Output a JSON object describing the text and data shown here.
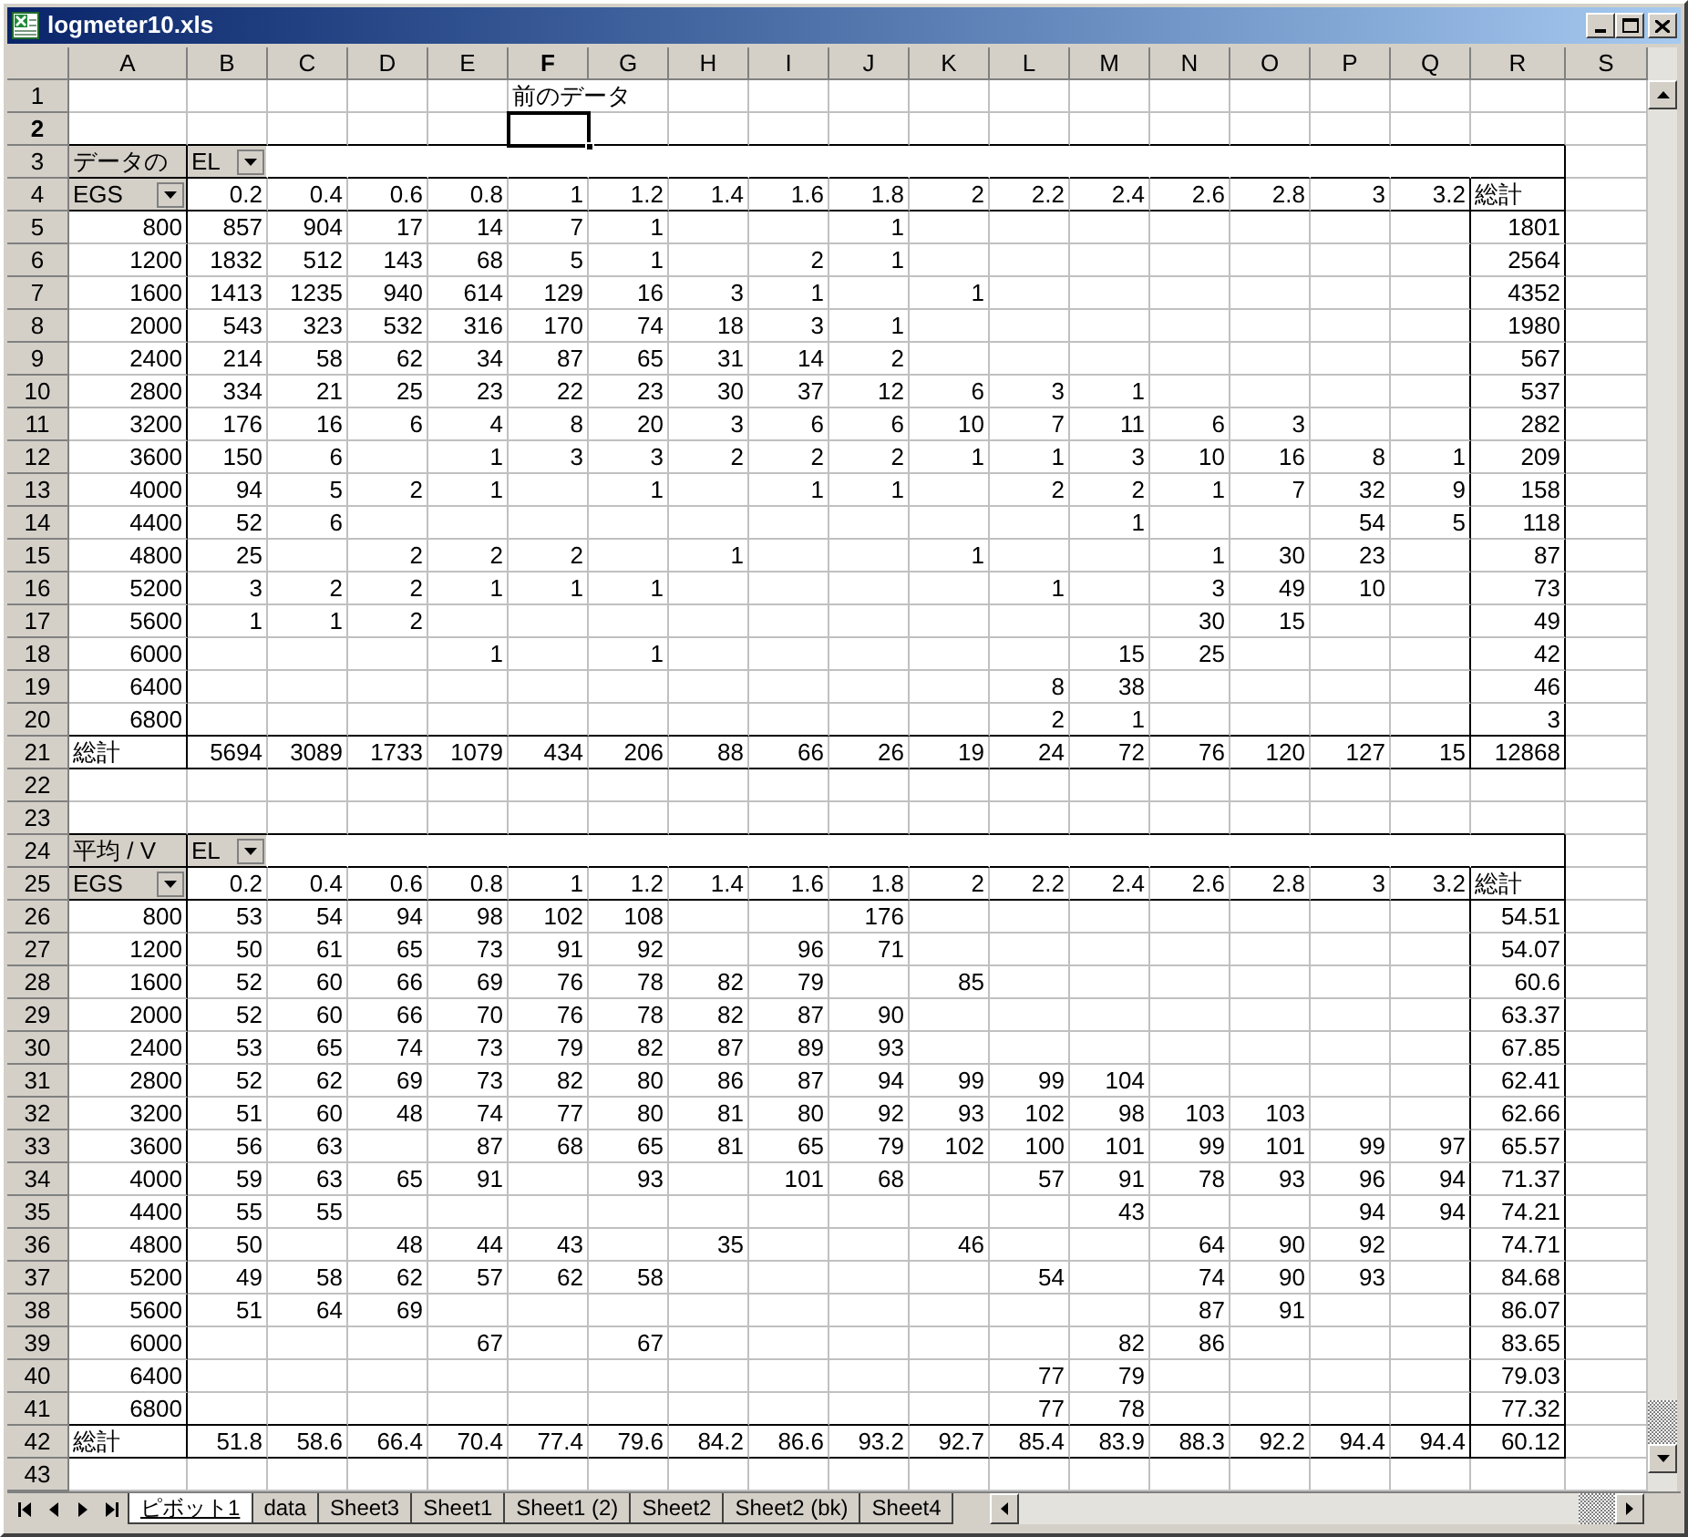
{
  "window": {
    "title": "logmeter10.xls"
  },
  "columns": [
    {
      "label": "A",
      "selected": false
    },
    {
      "label": "B",
      "selected": false
    },
    {
      "label": "C",
      "selected": false
    },
    {
      "label": "D",
      "selected": false
    },
    {
      "label": "E",
      "selected": false
    },
    {
      "label": "F",
      "selected": true
    },
    {
      "label": "G",
      "selected": false
    },
    {
      "label": "H",
      "selected": false
    },
    {
      "label": "I",
      "selected": false
    },
    {
      "label": "J",
      "selected": false
    },
    {
      "label": "K",
      "selected": false
    },
    {
      "label": "L",
      "selected": false
    },
    {
      "label": "M",
      "selected": false
    },
    {
      "label": "N",
      "selected": false
    },
    {
      "label": "O",
      "selected": false
    },
    {
      "label": "P",
      "selected": false
    },
    {
      "label": "Q",
      "selected": false
    },
    {
      "label": "R",
      "selected": false
    },
    {
      "label": "S",
      "selected": false
    }
  ],
  "rows": [
    {
      "number": "1",
      "selected": false,
      "kind": "blank",
      "cells": [
        null,
        null,
        null,
        null,
        null,
        {
          "text": "前のデータ",
          "kind": "label"
        }
      ]
    },
    {
      "number": "2",
      "selected": true,
      "kind": "blank",
      "cells": []
    },
    {
      "number": "3",
      "selected": false,
      "kind": "pivot_title",
      "cells": [
        {
          "text": "データの",
          "kind": "field",
          "dropdown": false
        },
        {
          "text": "EL",
          "kind": "field",
          "dropdown": true
        }
      ]
    },
    {
      "number": "4",
      "selected": false,
      "kind": "pivot_header",
      "cells": [
        {
          "text": "EGS",
          "kind": "field",
          "dropdown": true
        },
        "0.2",
        "0.4",
        "0.6",
        "0.8",
        "1",
        "1.2",
        "1.4",
        "1.6",
        "1.8",
        "2",
        "2.2",
        "2.4",
        "2.6",
        "2.8",
        "3",
        "3.2",
        {
          "text": "総計",
          "kind": "label"
        }
      ]
    },
    {
      "number": "5",
      "selected": false,
      "kind": "pivot_body",
      "cells": [
        "800",
        "857",
        "904",
        "17",
        "14",
        "7",
        "1",
        null,
        null,
        "1",
        null,
        null,
        null,
        null,
        null,
        null,
        null,
        "1801"
      ]
    },
    {
      "number": "6",
      "selected": false,
      "kind": "pivot_body",
      "cells": [
        "1200",
        "1832",
        "512",
        "143",
        "68",
        "5",
        "1",
        null,
        "2",
        "1",
        null,
        null,
        null,
        null,
        null,
        null,
        null,
        "2564"
      ]
    },
    {
      "number": "7",
      "selected": false,
      "kind": "pivot_body",
      "cells": [
        "1600",
        "1413",
        "1235",
        "940",
        "614",
        "129",
        "16",
        "3",
        "1",
        null,
        "1",
        null,
        null,
        null,
        null,
        null,
        null,
        "4352"
      ]
    },
    {
      "number": "8",
      "selected": false,
      "kind": "pivot_body",
      "cells": [
        "2000",
        "543",
        "323",
        "532",
        "316",
        "170",
        "74",
        "18",
        "3",
        "1",
        null,
        null,
        null,
        null,
        null,
        null,
        null,
        "1980"
      ]
    },
    {
      "number": "9",
      "selected": false,
      "kind": "pivot_body",
      "cells": [
        "2400",
        "214",
        "58",
        "62",
        "34",
        "87",
        "65",
        "31",
        "14",
        "2",
        null,
        null,
        null,
        null,
        null,
        null,
        null,
        "567"
      ]
    },
    {
      "number": "10",
      "selected": false,
      "kind": "pivot_body",
      "cells": [
        "2800",
        "334",
        "21",
        "25",
        "23",
        "22",
        "23",
        "30",
        "37",
        "12",
        "6",
        "3",
        "1",
        null,
        null,
        null,
        null,
        "537"
      ]
    },
    {
      "number": "11",
      "selected": false,
      "kind": "pivot_body",
      "cells": [
        "3200",
        "176",
        "16",
        "6",
        "4",
        "8",
        "20",
        "3",
        "6",
        "6",
        "10",
        "7",
        "11",
        "6",
        "3",
        null,
        null,
        "282"
      ]
    },
    {
      "number": "12",
      "selected": false,
      "kind": "pivot_body",
      "cells": [
        "3600",
        "150",
        "6",
        null,
        "1",
        "3",
        "3",
        "2",
        "2",
        "2",
        "1",
        "1",
        "3",
        "10",
        "16",
        "8",
        "1",
        "209"
      ]
    },
    {
      "number": "13",
      "selected": false,
      "kind": "pivot_body",
      "cells": [
        "4000",
        "94",
        "5",
        "2",
        "1",
        null,
        "1",
        null,
        "1",
        "1",
        null,
        "2",
        "2",
        "1",
        "7",
        "32",
        "9",
        "158"
      ]
    },
    {
      "number": "14",
      "selected": false,
      "kind": "pivot_body",
      "cells": [
        "4400",
        "52",
        "6",
        null,
        null,
        null,
        null,
        null,
        null,
        null,
        null,
        null,
        "1",
        null,
        null,
        "54",
        "5",
        "118"
      ]
    },
    {
      "number": "15",
      "selected": false,
      "kind": "pivot_body",
      "cells": [
        "4800",
        "25",
        null,
        "2",
        "2",
        "2",
        null,
        "1",
        null,
        null,
        "1",
        null,
        null,
        "1",
        "30",
        "23",
        null,
        "87"
      ]
    },
    {
      "number": "16",
      "selected": false,
      "kind": "pivot_body",
      "cells": [
        "5200",
        "3",
        "2",
        "2",
        "1",
        "1",
        "1",
        null,
        null,
        null,
        null,
        "1",
        null,
        "3",
        "49",
        "10",
        null,
        "73"
      ]
    },
    {
      "number": "17",
      "selected": false,
      "kind": "pivot_body",
      "cells": [
        "5600",
        "1",
        "1",
        "2",
        null,
        null,
        null,
        null,
        null,
        null,
        null,
        null,
        null,
        "30",
        "15",
        null,
        null,
        "49"
      ]
    },
    {
      "number": "18",
      "selected": false,
      "kind": "pivot_body",
      "cells": [
        "6000",
        null,
        null,
        null,
        "1",
        null,
        "1",
        null,
        null,
        null,
        null,
        null,
        "15",
        "25",
        null,
        null,
        null,
        "42"
      ]
    },
    {
      "number": "19",
      "selected": false,
      "kind": "pivot_body",
      "cells": [
        "6400",
        null,
        null,
        null,
        null,
        null,
        null,
        null,
        null,
        null,
        null,
        "8",
        "38",
        null,
        null,
        null,
        null,
        "46"
      ]
    },
    {
      "number": "20",
      "selected": false,
      "kind": "pivot_body",
      "cells": [
        "6800",
        null,
        null,
        null,
        null,
        null,
        null,
        null,
        null,
        null,
        null,
        "2",
        "1",
        null,
        null,
        null,
        null,
        "3"
      ]
    },
    {
      "number": "21",
      "selected": false,
      "kind": "pivot_total",
      "cells": [
        {
          "text": "総計",
          "kind": "label"
        },
        "5694",
        "3089",
        "1733",
        "1079",
        "434",
        "206",
        "88",
        "66",
        "26",
        "19",
        "24",
        "72",
        "76",
        "120",
        "127",
        "15",
        "12868"
      ]
    },
    {
      "number": "22",
      "selected": false,
      "kind": "blank",
      "cells": []
    },
    {
      "number": "23",
      "selected": false,
      "kind": "blank",
      "cells": []
    },
    {
      "number": "24",
      "selected": false,
      "kind": "pivot_title",
      "cells": [
        {
          "text": "平均 / V",
          "kind": "field",
          "dropdown": false
        },
        {
          "text": "EL",
          "kind": "field",
          "dropdown": true
        }
      ]
    },
    {
      "number": "25",
      "selected": false,
      "kind": "pivot_header",
      "cells": [
        {
          "text": "EGS",
          "kind": "field",
          "dropdown": true
        },
        "0.2",
        "0.4",
        "0.6",
        "0.8",
        "1",
        "1.2",
        "1.4",
        "1.6",
        "1.8",
        "2",
        "2.2",
        "2.4",
        "2.6",
        "2.8",
        "3",
        "3.2",
        {
          "text": "総計",
          "kind": "label"
        }
      ]
    },
    {
      "number": "26",
      "selected": false,
      "kind": "pivot_body",
      "cells": [
        "800",
        "53",
        "54",
        "94",
        "98",
        "102",
        "108",
        null,
        null,
        "176",
        null,
        null,
        null,
        null,
        null,
        null,
        null,
        "54.51"
      ]
    },
    {
      "number": "27",
      "selected": false,
      "kind": "pivot_body",
      "cells": [
        "1200",
        "50",
        "61",
        "65",
        "73",
        "91",
        "92",
        null,
        "96",
        "71",
        null,
        null,
        null,
        null,
        null,
        null,
        null,
        "54.07"
      ]
    },
    {
      "number": "28",
      "selected": false,
      "kind": "pivot_body",
      "cells": [
        "1600",
        "52",
        "60",
        "66",
        "69",
        "76",
        "78",
        "82",
        "79",
        null,
        "85",
        null,
        null,
        null,
        null,
        null,
        null,
        "60.6"
      ]
    },
    {
      "number": "29",
      "selected": false,
      "kind": "pivot_body",
      "cells": [
        "2000",
        "52",
        "60",
        "66",
        "70",
        "76",
        "78",
        "82",
        "87",
        "90",
        null,
        null,
        null,
        null,
        null,
        null,
        null,
        "63.37"
      ]
    },
    {
      "number": "30",
      "selected": false,
      "kind": "pivot_body",
      "cells": [
        "2400",
        "53",
        "65",
        "74",
        "73",
        "79",
        "82",
        "87",
        "89",
        "93",
        null,
        null,
        null,
        null,
        null,
        null,
        null,
        "67.85"
      ]
    },
    {
      "number": "31",
      "selected": false,
      "kind": "pivot_body",
      "cells": [
        "2800",
        "52",
        "62",
        "69",
        "73",
        "82",
        "80",
        "86",
        "87",
        "94",
        "99",
        "99",
        "104",
        null,
        null,
        null,
        null,
        "62.41"
      ]
    },
    {
      "number": "32",
      "selected": false,
      "kind": "pivot_body",
      "cells": [
        "3200",
        "51",
        "60",
        "48",
        "74",
        "77",
        "80",
        "81",
        "80",
        "92",
        "93",
        "102",
        "98",
        "103",
        "103",
        null,
        null,
        "62.66"
      ]
    },
    {
      "number": "33",
      "selected": false,
      "kind": "pivot_body",
      "cells": [
        "3600",
        "56",
        "63",
        null,
        "87",
        "68",
        "65",
        "81",
        "65",
        "79",
        "102",
        "100",
        "101",
        "99",
        "101",
        "99",
        "97",
        "65.57"
      ]
    },
    {
      "number": "34",
      "selected": false,
      "kind": "pivot_body",
      "cells": [
        "4000",
        "59",
        "63",
        "65",
        "91",
        null,
        "93",
        null,
        "101",
        "68",
        null,
        "57",
        "91",
        "78",
        "93",
        "96",
        "94",
        "71.37"
      ]
    },
    {
      "number": "35",
      "selected": false,
      "kind": "pivot_body",
      "cells": [
        "4400",
        "55",
        "55",
        null,
        null,
        null,
        null,
        null,
        null,
        null,
        null,
        null,
        "43",
        null,
        null,
        "94",
        "94",
        "74.21"
      ]
    },
    {
      "number": "36",
      "selected": false,
      "kind": "pivot_body",
      "cells": [
        "4800",
        "50",
        null,
        "48",
        "44",
        "43",
        null,
        "35",
        null,
        null,
        "46",
        null,
        null,
        "64",
        "90",
        "92",
        null,
        "74.71"
      ]
    },
    {
      "number": "37",
      "selected": false,
      "kind": "pivot_body",
      "cells": [
        "5200",
        "49",
        "58",
        "62",
        "57",
        "62",
        "58",
        null,
        null,
        null,
        null,
        "54",
        null,
        "74",
        "90",
        "93",
        null,
        "84.68"
      ]
    },
    {
      "number": "38",
      "selected": false,
      "kind": "pivot_body",
      "cells": [
        "5600",
        "51",
        "64",
        "69",
        null,
        null,
        null,
        null,
        null,
        null,
        null,
        null,
        null,
        "87",
        "91",
        null,
        null,
        "86.07"
      ]
    },
    {
      "number": "39",
      "selected": false,
      "kind": "pivot_body",
      "cells": [
        "6000",
        null,
        null,
        null,
        "67",
        null,
        "67",
        null,
        null,
        null,
        null,
        null,
        "82",
        "86",
        null,
        null,
        null,
        "83.65"
      ]
    },
    {
      "number": "40",
      "selected": false,
      "kind": "pivot_body",
      "cells": [
        "6400",
        null,
        null,
        null,
        null,
        null,
        null,
        null,
        null,
        null,
        null,
        "77",
        "79",
        null,
        null,
        null,
        null,
        "79.03"
      ]
    },
    {
      "number": "41",
      "selected": false,
      "kind": "pivot_body",
      "cells": [
        "6800",
        null,
        null,
        null,
        null,
        null,
        null,
        null,
        null,
        null,
        null,
        "77",
        "78",
        null,
        null,
        null,
        null,
        "77.32"
      ]
    },
    {
      "number": "42",
      "selected": false,
      "kind": "pivot_total",
      "cells": [
        {
          "text": "総計",
          "kind": "label"
        },
        "51.8",
        "58.6",
        "66.4",
        "70.4",
        "77.4",
        "79.6",
        "84.2",
        "86.6",
        "93.2",
        "92.7",
        "85.4",
        "83.9",
        "88.3",
        "92.2",
        "94.4",
        "94.4",
        "60.12"
      ]
    },
    {
      "number": "43",
      "selected": false,
      "kind": "blank",
      "cells": []
    }
  ],
  "sheet_tabs": [
    {
      "label": "ピボット1",
      "selected": true
    },
    {
      "label": "data",
      "selected": false
    },
    {
      "label": "Sheet3",
      "selected": false
    },
    {
      "label": "Sheet1",
      "selected": false
    },
    {
      "label": "Sheet1 (2)",
      "selected": false
    },
    {
      "label": "Sheet2",
      "selected": false
    },
    {
      "label": "Sheet2 (bk)",
      "selected": false
    },
    {
      "label": "Sheet4",
      "selected": false
    }
  ]
}
